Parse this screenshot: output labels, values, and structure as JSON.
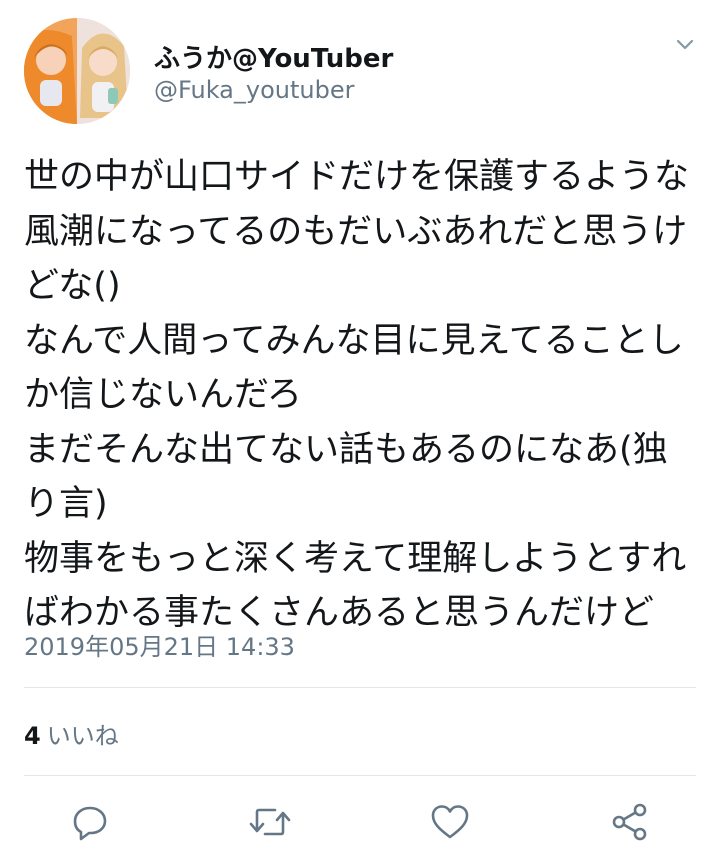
{
  "tweet": {
    "author": {
      "display_name": "ふうか@YouTuber",
      "handle": "@Fuka_youtuber",
      "avatar_icon": "profile-photo-icon"
    },
    "menu_icon": "chevron-down-icon",
    "text": "世の中が山口サイドだけを保護するような風潮になってるのもだいぶあれだと思うけどな()\nなんで人間ってみんな目に見えてることしか信じないんだろ\nまだそんな出てない話もあるのになあ(独り言)\n物事をもっと深く考えて理解しようとすればわかる事たくさんあると思うんだけど",
    "timestamp": "2019年05月21日 14:33",
    "stats": {
      "likes_count": "4",
      "likes_label": "いいね"
    },
    "actions": {
      "reply_icon": "reply-icon",
      "retweet_icon": "retweet-icon",
      "like_icon": "heart-icon",
      "share_icon": "share-icon"
    }
  },
  "colors": {
    "text_primary": "#14171a",
    "text_secondary": "#657786",
    "divider": "#e1e8ed",
    "icon": "#657786"
  }
}
